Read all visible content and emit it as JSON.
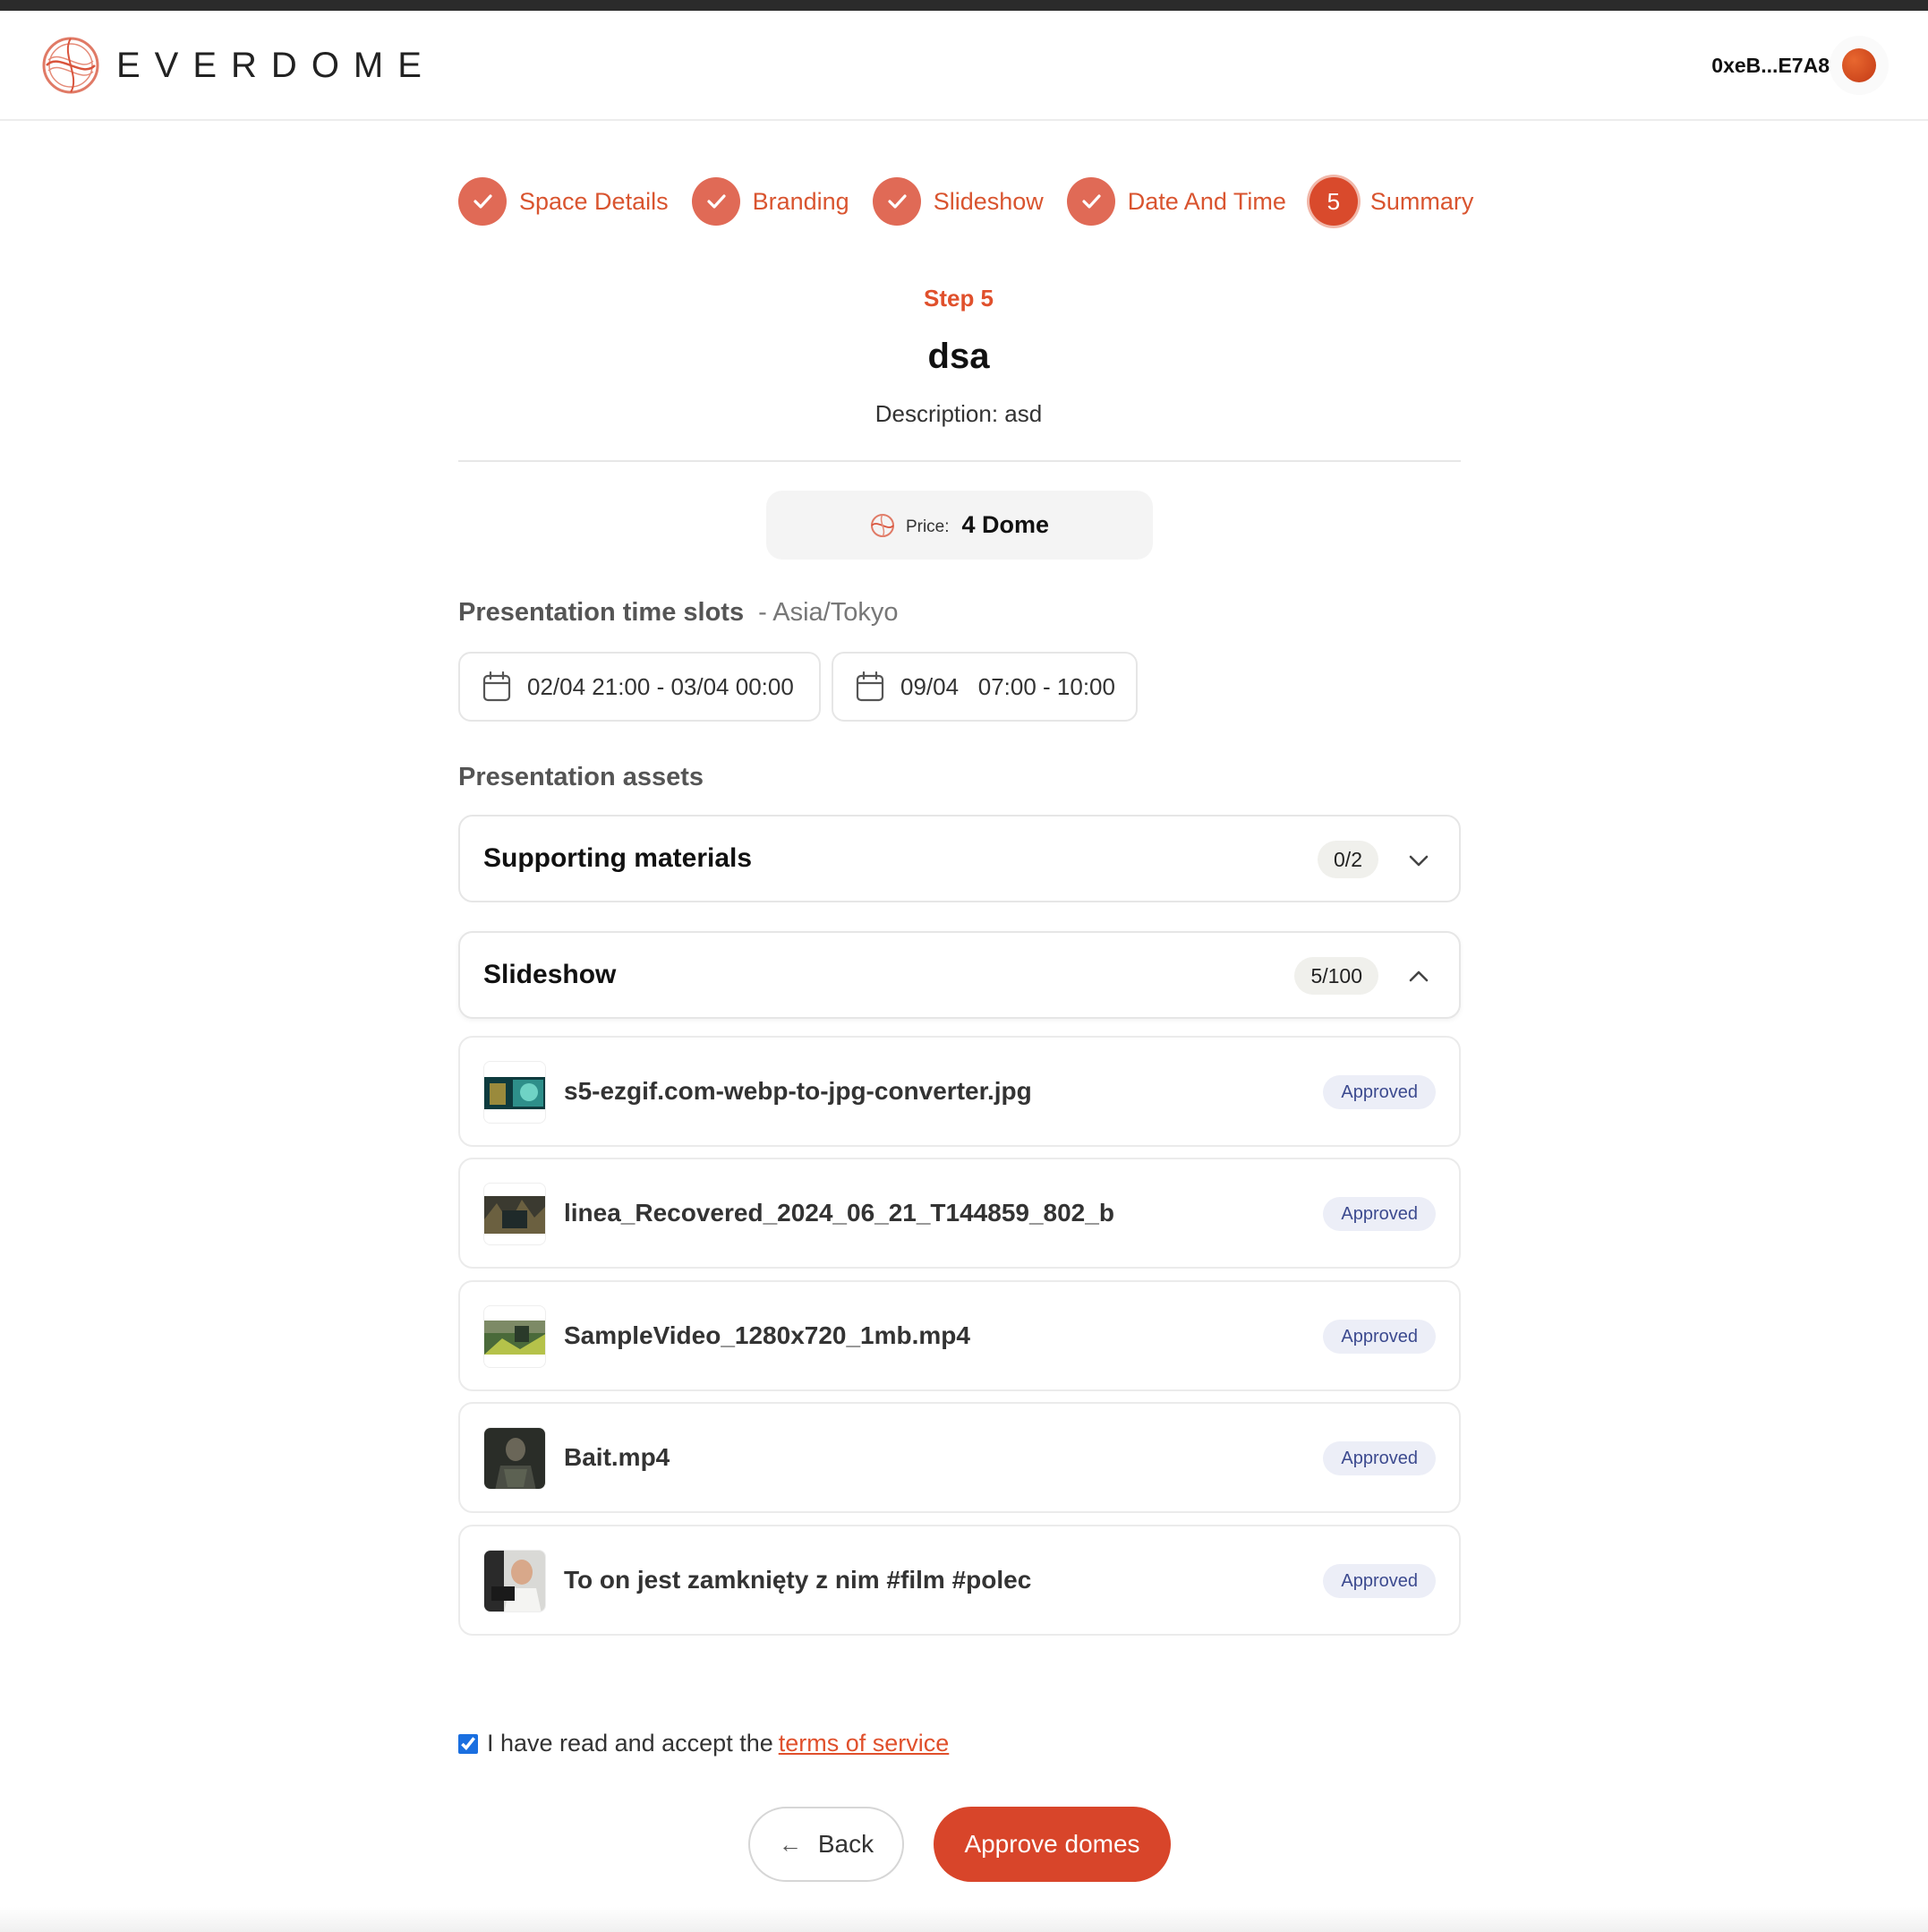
{
  "header": {
    "logo_text": "EVERDOME",
    "wallet_address": "0xeB...E7A8"
  },
  "stepper": {
    "steps": [
      {
        "label": "Space Details",
        "status": "done"
      },
      {
        "label": "Branding",
        "status": "done"
      },
      {
        "label": "Slideshow",
        "status": "done"
      },
      {
        "label": "Date And Time",
        "status": "done"
      },
      {
        "label": "Summary",
        "status": "current",
        "number": "5"
      }
    ]
  },
  "summary": {
    "step_label": "Step 5",
    "title": "dsa",
    "description": "Description: asd",
    "price_label": "Price:",
    "price_value": "4 Dome"
  },
  "time_slots": {
    "label": "Presentation time slots",
    "timezone": "- Asia/Tokyo",
    "slots": [
      "02/04 21:00 - 03/04 00:00",
      "09/04   07:00 - 10:00"
    ]
  },
  "assets": {
    "label": "Presentation assets",
    "supporting": {
      "title": "Supporting materials",
      "count": "0/2"
    },
    "slideshow": {
      "title": "Slideshow",
      "count": "5/100"
    },
    "items": [
      {
        "name": "s5-ezgif.com-webp-to-jpg-converter.jpg",
        "status": "Approved"
      },
      {
        "name": "linea_Recovered_2024_06_21_T144859_802_b",
        "status": "Approved"
      },
      {
        "name": "SampleVideo_1280x720_1mb.mp4",
        "status": "Approved"
      },
      {
        "name": "Bait.mp4",
        "status": "Approved"
      },
      {
        "name": "To on jest zamknięty z nim #film #polec",
        "status": "Approved"
      }
    ]
  },
  "terms": {
    "text": "I have read and accept the",
    "link": "terms of service",
    "checked": true
  },
  "actions": {
    "back": "Back",
    "approve": "Approve domes"
  },
  "colors": {
    "accent": "#d8452a",
    "step_done": "#e06a56",
    "badge_bg": "#eceef7",
    "badge_text": "#3c4a8f"
  },
  "icons": [
    "everdome-logo-icon",
    "check-icon",
    "calendar-icon",
    "chevron-down-icon",
    "chevron-up-icon",
    "arrow-left-icon",
    "dome-coin-icon"
  ]
}
